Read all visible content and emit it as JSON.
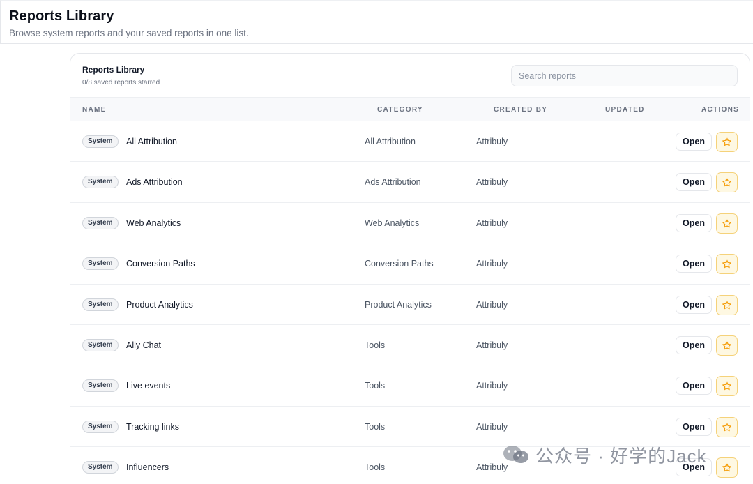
{
  "header": {
    "title": "Reports Library",
    "subtitle": "Browse system reports and your saved reports in one list."
  },
  "card": {
    "title": "Reports Library",
    "subtitle": "0/8 saved reports starred",
    "search_placeholder": "Search reports"
  },
  "columns": {
    "name": "NAME",
    "category": "CATEGORY",
    "created_by": "CREATED BY",
    "updated": "UPDATED",
    "actions": "ACTIONS"
  },
  "rows": [
    {
      "badge": "System",
      "name": "All Attribution",
      "category": "All Attribution",
      "created_by": "Attribuly",
      "updated": "",
      "open_label": "Open"
    },
    {
      "badge": "System",
      "name": "Ads Attribution",
      "category": "Ads Attribution",
      "created_by": "Attribuly",
      "updated": "",
      "open_label": "Open"
    },
    {
      "badge": "System",
      "name": "Web Analytics",
      "category": "Web Analytics",
      "created_by": "Attribuly",
      "updated": "",
      "open_label": "Open"
    },
    {
      "badge": "System",
      "name": "Conversion Paths",
      "category": "Conversion Paths",
      "created_by": "Attribuly",
      "updated": "",
      "open_label": "Open"
    },
    {
      "badge": "System",
      "name": "Product Analytics",
      "category": "Product Analytics",
      "created_by": "Attribuly",
      "updated": "",
      "open_label": "Open"
    },
    {
      "badge": "System",
      "name": "Ally Chat",
      "category": "Tools",
      "created_by": "Attribuly",
      "updated": "",
      "open_label": "Open"
    },
    {
      "badge": "System",
      "name": "Live events",
      "category": "Tools",
      "created_by": "Attribuly",
      "updated": "",
      "open_label": "Open"
    },
    {
      "badge": "System",
      "name": "Tracking links",
      "category": "Tools",
      "created_by": "Attribuly",
      "updated": "",
      "open_label": "Open"
    },
    {
      "badge": "System",
      "name": "Influencers",
      "category": "Tools",
      "created_by": "Attribuly",
      "updated": "",
      "open_label": "Open"
    }
  ],
  "icons": {
    "star": "star-outline-icon",
    "watermark": "wechat-icon"
  },
  "colors": {
    "accent_star": "#f59e0b",
    "star_bg": "#fef8e2",
    "badge_bg": "#f3f4f6"
  },
  "watermark": {
    "text": "公众号 · 好学的Jack"
  }
}
